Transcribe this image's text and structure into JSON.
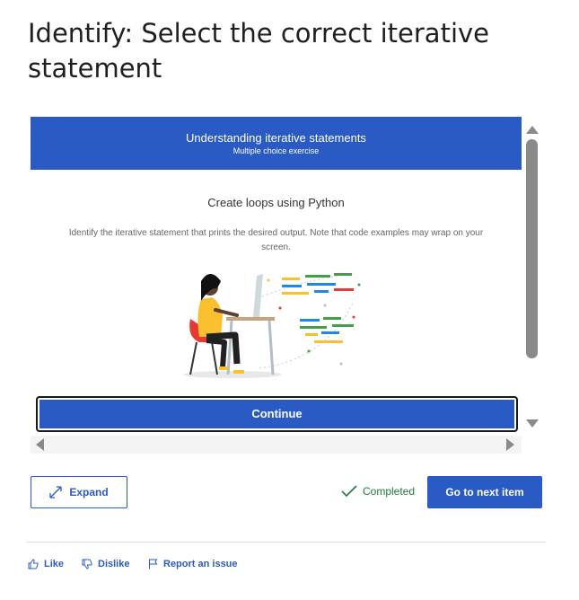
{
  "page": {
    "title": "Identify: Select the correct iterative statement"
  },
  "exercise": {
    "header_title": "Understanding iterative statements",
    "header_subtitle": "Multiple choice exercise",
    "content_title": "Create loops using Python",
    "content_description": "Identify the iterative statement that prints the desired output. Note that code examples may wrap on your screen.",
    "continue_label": "Continue",
    "accent_color": "#2a5ac3"
  },
  "controls": {
    "expand_label": "Expand",
    "completed_label": "Completed",
    "next_label": "Go to next item"
  },
  "footer": {
    "like_label": "Like",
    "dislike_label": "Dislike",
    "report_label": "Report an issue"
  },
  "icons": {
    "expand": "expand-icon",
    "completed": "checkmark-icon",
    "like": "thumbs-up-icon",
    "dislike": "thumbs-down-icon",
    "report": "flag-icon"
  }
}
